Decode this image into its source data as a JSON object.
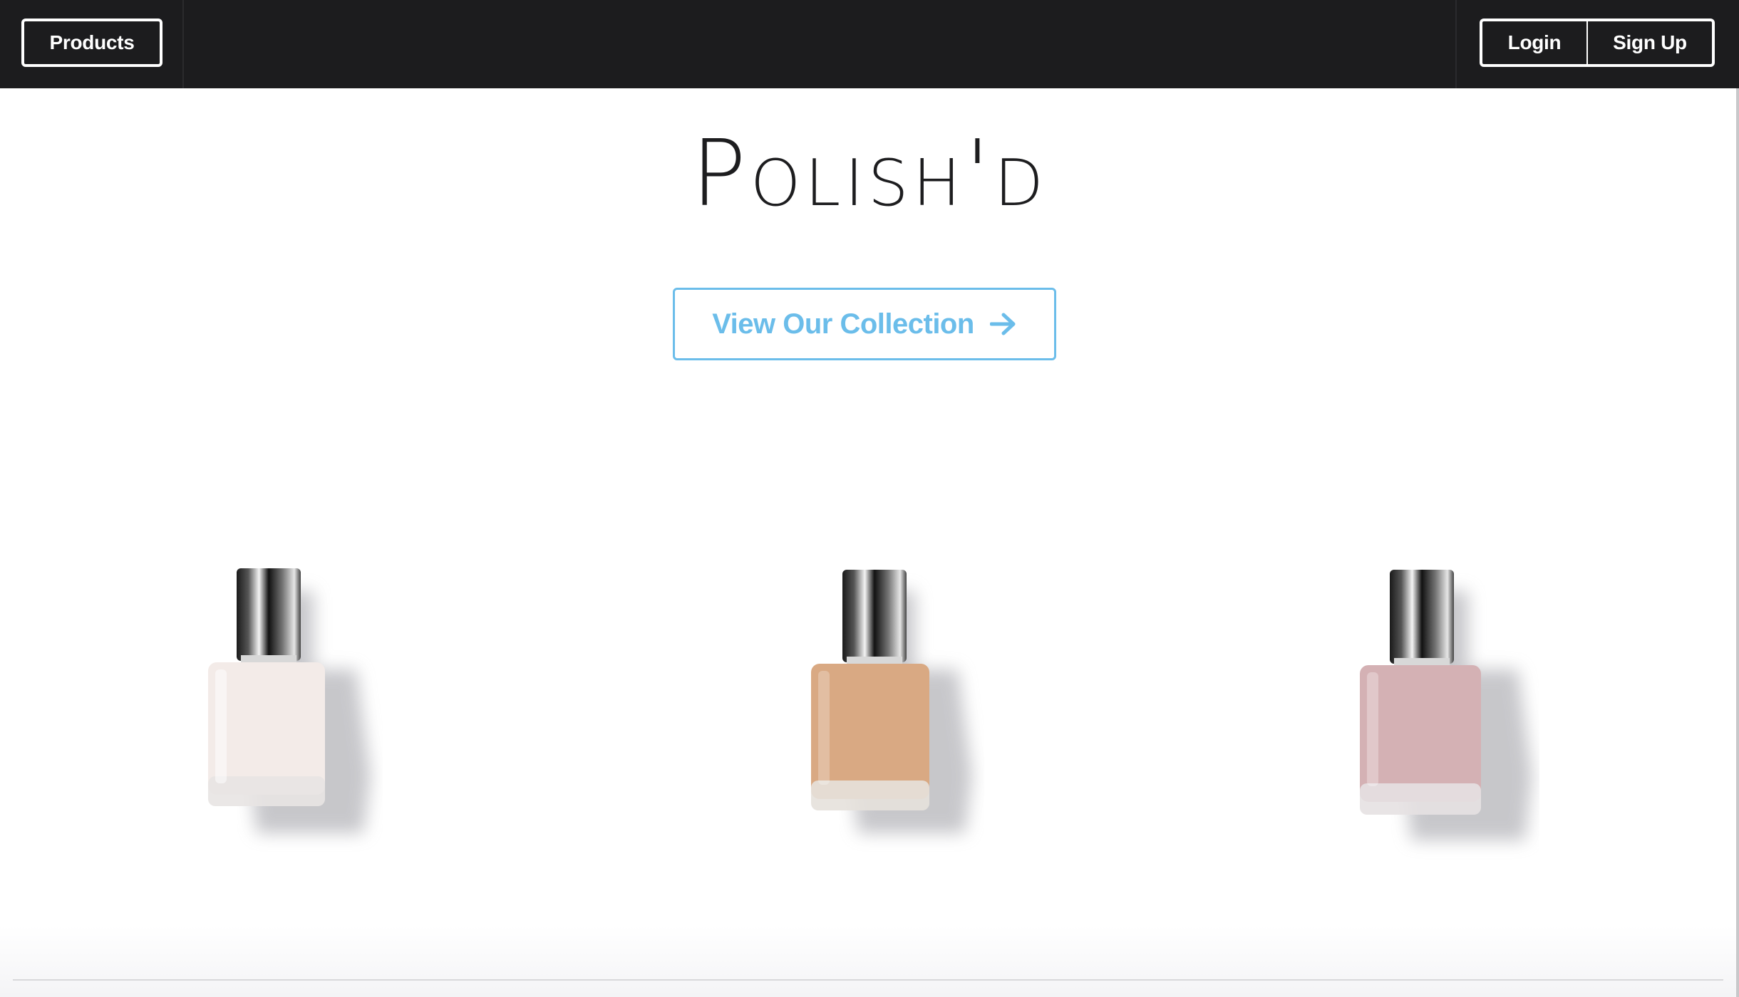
{
  "nav": {
    "products_label": "Products",
    "login_label": "Login",
    "signup_label": "Sign Up"
  },
  "brand": {
    "name": "Polish'd"
  },
  "hero": {
    "cta_label": "View Our Collection",
    "cta_icon": "arrow-right-icon"
  },
  "products": [
    {
      "name": "nail-polish-bottle",
      "color": "#f3ebe8"
    },
    {
      "name": "nail-polish-bottle",
      "color": "#d9a983"
    },
    {
      "name": "nail-polish-bottle",
      "color": "#d4b1b4"
    }
  ],
  "colors": {
    "navbar": "#1c1c1e",
    "accent": "#6bbdea",
    "text": "#1d1d1f"
  }
}
